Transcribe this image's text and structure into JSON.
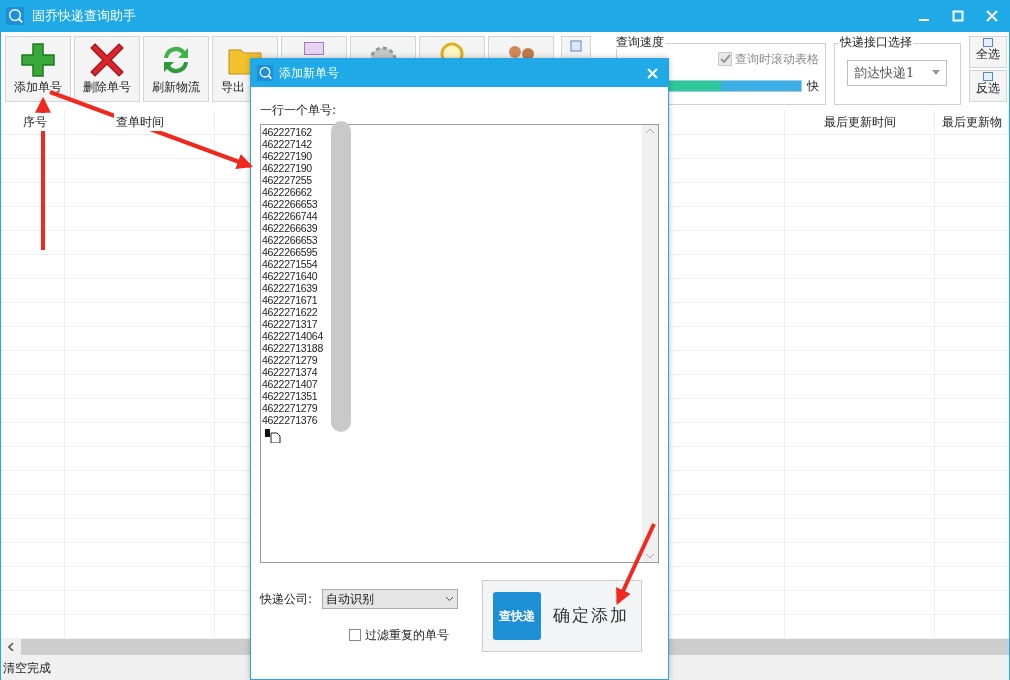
{
  "window": {
    "title": "固乔快递查询助手"
  },
  "toolbar": [
    {
      "kind": "add",
      "label": "添加单号"
    },
    {
      "kind": "delete",
      "label": "删除单号"
    },
    {
      "kind": "refresh",
      "label": "刷新物流"
    },
    {
      "kind": "folder",
      "label": "导出"
    },
    {
      "kind": "document"
    },
    {
      "kind": "gear"
    },
    {
      "kind": "magnifier"
    },
    {
      "kind": "people"
    }
  ],
  "speed_group": {
    "title": "查询速度",
    "scroll_checkbox": {
      "label": "查询时滚动表格",
      "checked": true,
      "disabled": true
    },
    "slider": {
      "level": 0.55
    },
    "fast_label": "快"
  },
  "api_group": {
    "title": "快递接口选择",
    "select": {
      "value": "韵达快递1"
    }
  },
  "select_buttons": [
    "全选",
    "反选"
  ],
  "table": {
    "columns": [
      "序号",
      "查单时间",
      "最后更新时间",
      "最后更新物"
    ]
  },
  "status_bar": "清空完成",
  "dialog": {
    "title": "添加新单号",
    "prompt": "一行一个单号:",
    "numbers": [
      "462227162",
      "462227142",
      "462227190",
      "462227190",
      "462227255",
      "462226662",
      "4622266653",
      "4622266744",
      "4622266639",
      "4622266653",
      "4622266595",
      "4622271554",
      "4622271640",
      "4622271639",
      "4622271671",
      "4622271622",
      "4622271317",
      "46222714064",
      "46222713188",
      "4622271279",
      "4622271374",
      "4622271407",
      "4622271351",
      "4622271279",
      "4622271376"
    ],
    "company_label": "快递公司:",
    "company_select": {
      "value": "自动识别"
    },
    "filter_checkbox": {
      "label": "过滤重复的单号",
      "checked": false
    },
    "confirm_button": {
      "logo_text": "查快递",
      "label": "确定添加"
    }
  }
}
